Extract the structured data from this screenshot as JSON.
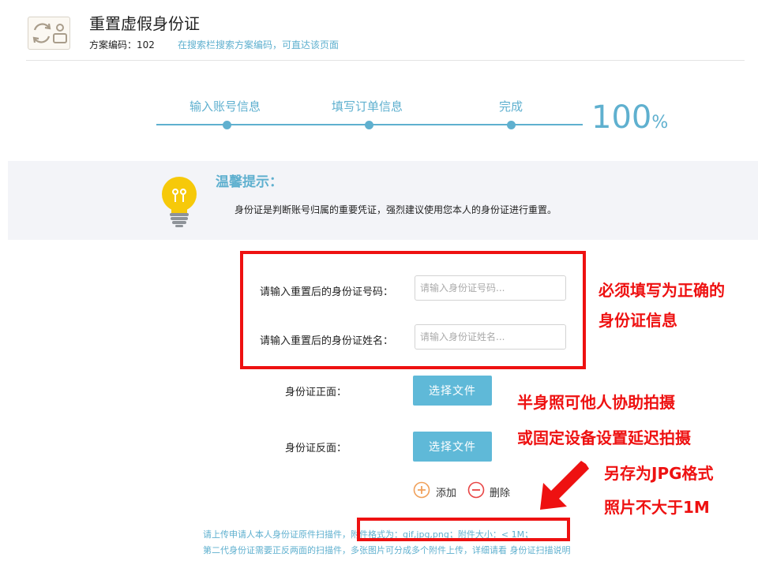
{
  "header": {
    "title": "重置虚假身份证",
    "plan_code": "方案编码：102",
    "search_hint": "在搜索栏搜索方案编码，可直达该页面",
    "logo_icon": "reset-card-icon"
  },
  "progress": {
    "steps": [
      {
        "label": "输入账号信息"
      },
      {
        "label": "填写订单信息"
      },
      {
        "label": "完成"
      }
    ],
    "value": "100",
    "unit": "%",
    "accent_color": "#5fb0cf"
  },
  "tip": {
    "title": "温馨提示：",
    "text": "身份证是判断账号归属的重要凭证，强烈建议使用您本人的身份证进行重置。",
    "icon": "lightbulb-icon"
  },
  "form": {
    "id_number_label": "请输入重置后的身份证号码：",
    "id_number_value": "",
    "id_number_placeholder": "请输入身份证号码...",
    "id_name_label": "请输入重置后的身份证姓名：",
    "id_name_value": "",
    "id_name_placeholder": "请输入身份证姓名...",
    "front_label": "身份证正面：",
    "back_label": "身份证反面：",
    "choose_file_label": "选择文件",
    "add_label": "添加",
    "delete_label": "删除"
  },
  "notes": {
    "line1_prefix": "请上传申请人本人身份证原件扫描件，",
    "line1_formats": "附件格式为：gif,jpg,png；附件大小：< 1M；",
    "line2_prefix": "第二代身份证需要正反两面的扫描件，多张图片可分成多个附件上传，详细请看 ",
    "line2_link": "身份证扫描说明"
  },
  "annotations": {
    "note_a_line1": "必须填写为正确的",
    "note_a_line2": "身份证信息",
    "note_b_line1": "半身照可他人协助拍摄",
    "note_b_line2": "或固定设备设置延迟拍摄",
    "note_c_line1": "另存为JPG格式",
    "note_c_line2": "照片不大于1M",
    "color": "#ee1111"
  }
}
